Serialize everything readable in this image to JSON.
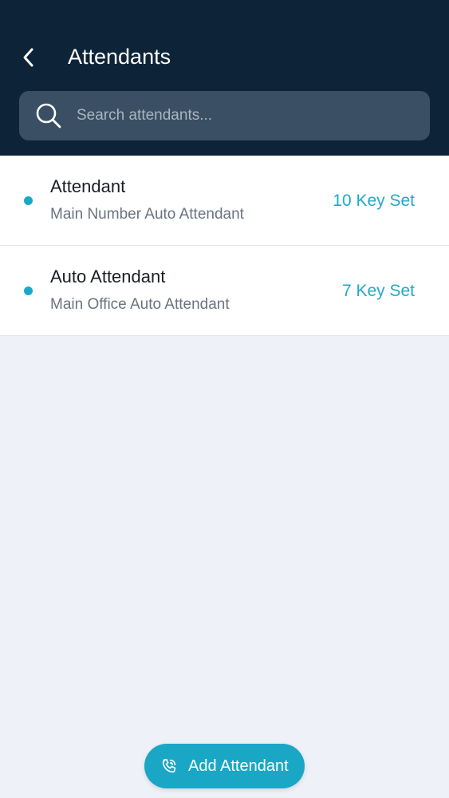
{
  "header": {
    "title": "Attendants",
    "back_icon": "chevron-left-icon"
  },
  "search": {
    "placeholder": "Search attendants...",
    "value": "",
    "icon": "search-icon"
  },
  "attendants": [
    {
      "name": "Attendant",
      "description": "Main Number Auto Attendant",
      "keyset": "10 Key Set"
    },
    {
      "name": "Auto Attendant",
      "description": "Main Office Auto Attendant",
      "keyset": "7 Key Set"
    }
  ],
  "fab": {
    "label": "Add Attendant",
    "icon": "phone-icon"
  },
  "colors": {
    "header_bg": "#0d2438",
    "search_bg": "#3a4f63",
    "accent": "#1aa7c6",
    "page_bg": "#eff1f8"
  }
}
